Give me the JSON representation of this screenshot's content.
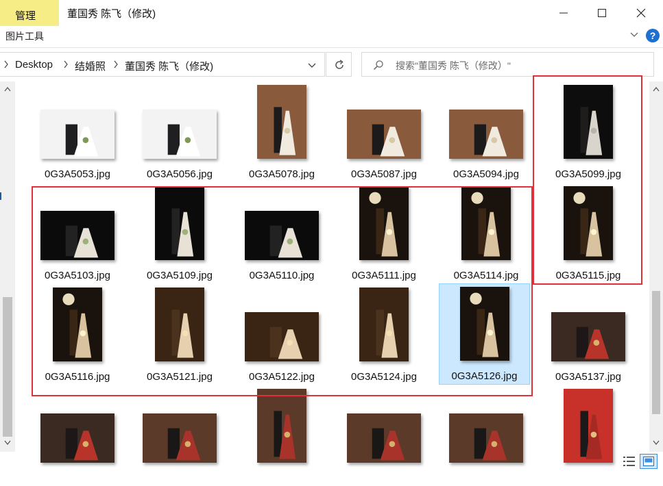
{
  "ribbon": {
    "manage_tab": "管理",
    "picture_tools": "图片工具",
    "help": "?"
  },
  "window": {
    "title": "董国秀 陈飞（修改)"
  },
  "address": {
    "crumbs": [
      "Desktop",
      "结婚照",
      "董国秀 陈飞（修改)"
    ]
  },
  "search": {
    "placeholder": "搜索\"董国秀 陈飞（修改）\""
  },
  "files": [
    {
      "name": "0G3A5053.jpg",
      "orientation": "landscape",
      "scene": "white-studio",
      "selected": false
    },
    {
      "name": "0G3A5056.jpg",
      "orientation": "landscape",
      "scene": "white-studio",
      "selected": false
    },
    {
      "name": "0G3A5078.jpg",
      "orientation": "portrait",
      "scene": "brown-studio",
      "selected": false
    },
    {
      "name": "0G3A5087.jpg",
      "orientation": "landscape",
      "scene": "brown-studio",
      "selected": false
    },
    {
      "name": "0G3A5094.jpg",
      "orientation": "landscape",
      "scene": "brown-studio",
      "selected": false
    },
    {
      "name": "0G3A5099.jpg",
      "orientation": "portrait",
      "scene": "dark-veil",
      "selected": false
    },
    {
      "name": "0G3A5103.jpg",
      "orientation": "landscape",
      "scene": "dark-couple",
      "selected": false
    },
    {
      "name": "0G3A5109.jpg",
      "orientation": "portrait",
      "scene": "dark-couple",
      "selected": false
    },
    {
      "name": "0G3A5110.jpg",
      "orientation": "landscape",
      "scene": "dark-couple",
      "selected": false
    },
    {
      "name": "0G3A5111.jpg",
      "orientation": "portrait",
      "scene": "dark-light",
      "selected": false
    },
    {
      "name": "0G3A5114.jpg",
      "orientation": "portrait",
      "scene": "dark-light",
      "selected": false
    },
    {
      "name": "0G3A5115.jpg",
      "orientation": "portrait",
      "scene": "dark-light",
      "selected": false
    },
    {
      "name": "0G3A5116.jpg",
      "orientation": "portrait",
      "scene": "dark-light",
      "selected": false
    },
    {
      "name": "0G3A5121.jpg",
      "orientation": "portrait",
      "scene": "warm-veil",
      "selected": false
    },
    {
      "name": "0G3A5122.jpg",
      "orientation": "landscape",
      "scene": "warm-veil",
      "selected": false
    },
    {
      "name": "0G3A5124.jpg",
      "orientation": "portrait",
      "scene": "warm-veil",
      "selected": false
    },
    {
      "name": "0G3A5126.jpg",
      "orientation": "portrait",
      "scene": "dark-light",
      "selected": true
    },
    {
      "name": "0G3A5137.jpg",
      "orientation": "landscape",
      "scene": "chinese-red",
      "selected": false
    },
    {
      "name": "",
      "orientation": "landscape",
      "scene": "chinese-red",
      "selected": false
    },
    {
      "name": "",
      "orientation": "landscape",
      "scene": "chinese-room",
      "selected": false
    },
    {
      "name": "",
      "orientation": "portrait",
      "scene": "chinese-room",
      "selected": false
    },
    {
      "name": "",
      "orientation": "landscape",
      "scene": "chinese-room",
      "selected": false
    },
    {
      "name": "",
      "orientation": "landscape",
      "scene": "chinese-room",
      "selected": false
    },
    {
      "name": "",
      "orientation": "portrait",
      "scene": "chinese-bright",
      "selected": false
    }
  ],
  "colors": {
    "manage_tab": "#f7ed87",
    "selection": "#cce8ff",
    "highlight_box": "#e0313b",
    "help_icon": "#1f6fd1"
  }
}
